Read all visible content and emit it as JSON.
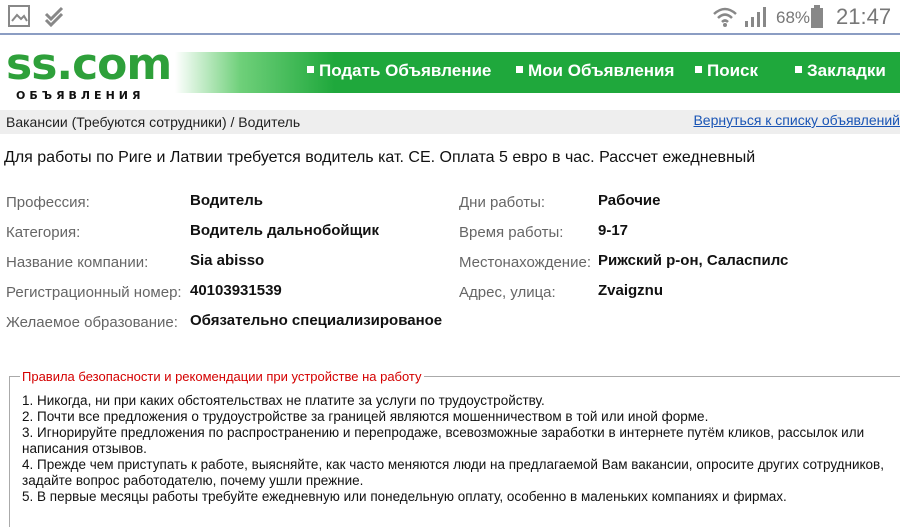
{
  "status_bar": {
    "battery_percent": "68%",
    "time": "21:47",
    "icons": [
      "gallery-icon",
      "download-done-icon",
      "wifi-icon",
      "signal-icon",
      "battery-icon"
    ]
  },
  "header": {
    "logo_main": "ss.com",
    "logo_sub": "ОБЪЯВЛЕНИЯ",
    "nav": [
      {
        "label": "Подать Объявление"
      },
      {
        "label": "Мои Объявления"
      },
      {
        "label": "Поиск"
      },
      {
        "label": "Закладки"
      }
    ]
  },
  "breadcrumb": {
    "path": "Вакансии (Требуются сотрудники) / Водитель",
    "back_link": "Вернуться к списку объявлений"
  },
  "ad": {
    "text": "Для работы по Риге и Латвии требуется водитель кат. СЕ. Оплата 5 евро в час. Рассчет ежедневный",
    "left_fields": [
      {
        "label": "Профессия:",
        "value": "Водитель"
      },
      {
        "label": "Категория:",
        "value": "Водитель дальнобойщик"
      },
      {
        "label": "Название компании:",
        "value": "Sia abisso"
      },
      {
        "label": "Регистрационный номер:",
        "value": "40103931539"
      },
      {
        "label": "Желаемое образование:",
        "value": "Обязательно специализированое"
      }
    ],
    "right_fields": [
      {
        "label": "Дни работы:",
        "value": "Рабочие"
      },
      {
        "label": "Время работы:",
        "value": "9-17"
      },
      {
        "label": "Местонахождение:",
        "value": "Рижский р-он, Саласпилс"
      },
      {
        "label": "Адрес, улица:",
        "value": "Zvaigznu"
      }
    ]
  },
  "safety": {
    "title": "Правила безопасности и рекомендации при устройстве на работу",
    "rules": [
      "1. Никогда, ни при каких обстоятельствах не платите за услуги по трудоустройству.",
      "2. Почти все предложения о трудоустройстве за границей являются мошенничеством в той или иной форме.",
      "3. Игнорируйте предложения по распространению и перепродаже, всевозможные заработки в интернете путём кликов, рассылок или написания отзывов.",
      "4. Прежде чем приступать к работе, выясняйте, как часто меняются люди на предлагаемой Вам вакансии, опросите других сотрудников, задайте вопрос работодателю, почему ушли прежние.",
      "5. В первые месяцы работы требуйте ежедневную или понедельную оплату, особенно в маленьких компаниях и фирмах."
    ]
  },
  "colors": {
    "brand_green": "#2ea03a",
    "nav_green": "#1fa83c",
    "link_blue": "#1a55b5",
    "rules_title_red": "#d40000"
  }
}
